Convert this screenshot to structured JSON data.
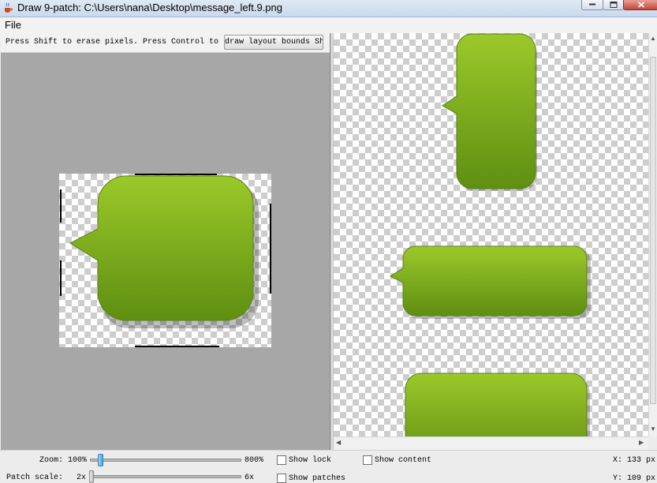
{
  "window": {
    "title": "Draw 9-patch: C:\\Users\\nana\\Desktop\\message_left.9.png"
  },
  "menu": {
    "file": "File"
  },
  "editor": {
    "hint": "Press Shift to erase pixels. Press Control to",
    "overlap_button_text": "draw layout bounds Show bad patches"
  },
  "status": {
    "zoom_label": "Zoom:",
    "zoom_value": "100%",
    "zoom_max": "800%",
    "zoom_level": 0.0,
    "patch_scale_label": "Patch scale:",
    "patch_scale_value": "2x",
    "patch_scale_max": "6x",
    "show_lock": "Show lock",
    "show_content": "Show content",
    "show_patches": "Show patches",
    "x_readout": "X: 133 px",
    "y_readout": "Y: 109 px"
  },
  "colors": {
    "bubble_top": "#9bc92a",
    "bubble_bottom": "#5e8f11",
    "editor_bg": "#a7a7a7",
    "accent_thumb": "#3fa6e0"
  },
  "icons": {
    "app": "java-cup-icon",
    "minimize": "minimize-icon",
    "maximize": "maximize-icon",
    "close": "close-icon"
  }
}
